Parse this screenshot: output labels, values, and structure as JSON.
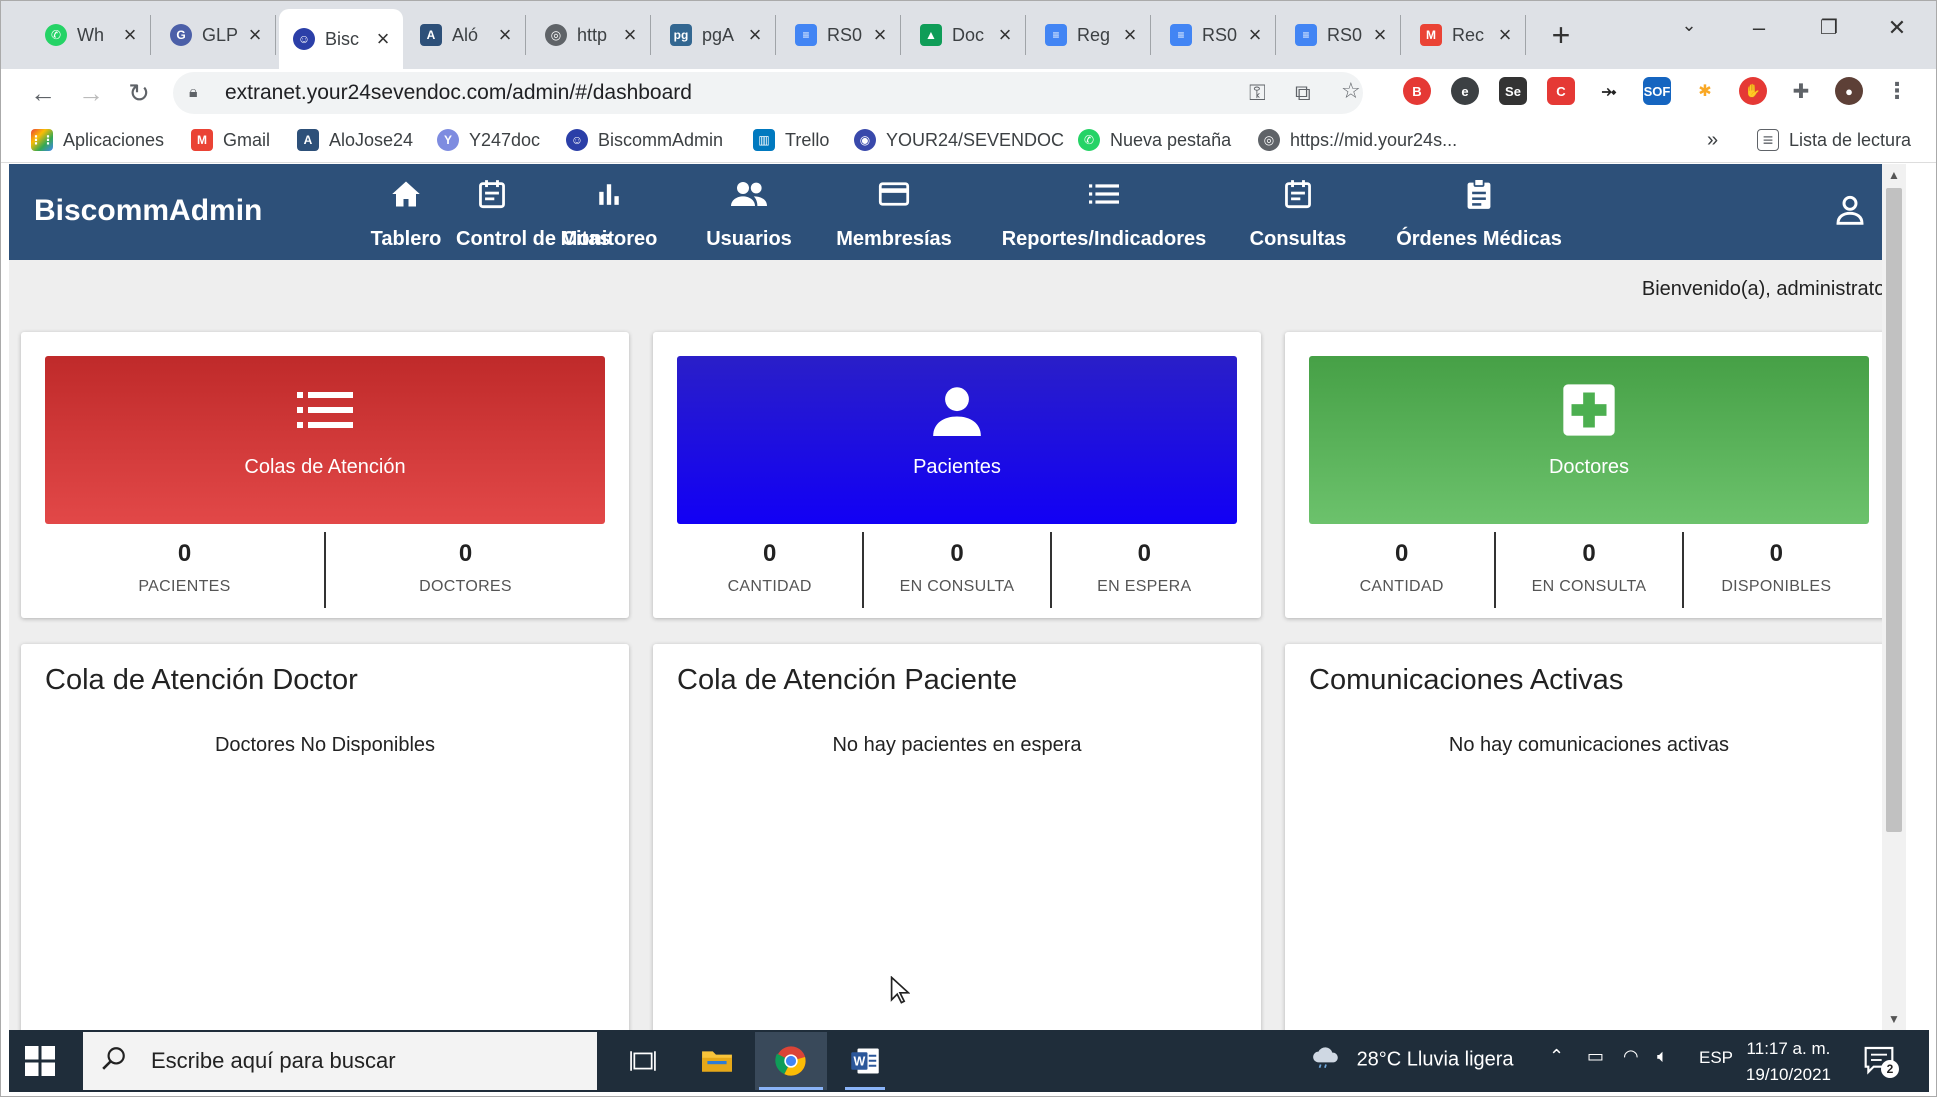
{
  "browser": {
    "tabs": [
      {
        "title": "Wh",
        "favicon": "whatsapp-icon",
        "color": "#25d366"
      },
      {
        "title": "GLP",
        "favicon": "glpi-icon",
        "color": "#4b5fa8"
      },
      {
        "title": "Bisc",
        "favicon": "biscomm-icon",
        "color": "#2b3fa8",
        "active": true
      },
      {
        "title": "Aló",
        "favicon": "alojose-icon",
        "color": "#2d5079"
      },
      {
        "title": "http",
        "favicon": "globe-icon",
        "color": "#5f6368"
      },
      {
        "title": "pgA",
        "favicon": "pgadmin-icon",
        "color": "#336791"
      },
      {
        "title": "RS0",
        "favicon": "docs-icon",
        "color": "#4285f4"
      },
      {
        "title": "Doc",
        "favicon": "drive-icon",
        "color": "#0f9d58"
      },
      {
        "title": "Reg",
        "favicon": "docs-icon",
        "color": "#4285f4"
      },
      {
        "title": "RS0",
        "favicon": "docs-icon",
        "color": "#4285f4"
      },
      {
        "title": "RS0",
        "favicon": "docs-icon",
        "color": "#4285f4"
      },
      {
        "title": "Rec",
        "favicon": "gmail-icon",
        "color": "#ea4335"
      }
    ],
    "url": "extranet.your24sevendoc.com/admin/#/dashboard",
    "bookmarks": [
      {
        "label": "Aplicaciones",
        "icon": "apps-grid-icon"
      },
      {
        "label": "Gmail",
        "icon": "gmail-icon"
      },
      {
        "label": "AloJose24",
        "icon": "alojose-icon"
      },
      {
        "label": "Y247doc",
        "icon": "y247doc-icon"
      },
      {
        "label": "BiscommAdmin",
        "icon": "biscomm-icon"
      },
      {
        "label": "Trello",
        "icon": "trello-icon"
      },
      {
        "label": "YOUR24/SEVENDOC",
        "icon": "your24-icon"
      },
      {
        "label": "Nueva pestaña",
        "icon": "whatsapp-icon"
      },
      {
        "label": "https://mid.your24s...",
        "icon": "globe-icon"
      }
    ],
    "overflow_label": "»",
    "reading_list": "Lista de lectura"
  },
  "app": {
    "brand": "BiscommAdmin",
    "nav": [
      {
        "label": "Tablero",
        "icon": "home-icon"
      },
      {
        "label": "Control de Citas",
        "icon": "calendar-icon"
      },
      {
        "label": "Monitoreo",
        "icon": "bar-chart-icon"
      },
      {
        "label": "Usuarios",
        "icon": "users-icon"
      },
      {
        "label": "Membresías",
        "icon": "credit-card-icon"
      },
      {
        "label": "Reportes/Indicadores",
        "icon": "list-icon"
      },
      {
        "label": "Consultas",
        "icon": "calendar-icon"
      },
      {
        "label": "Órdenes Médicas",
        "icon": "clipboard-icon"
      }
    ],
    "welcome": "Bienvenido(a), administrator",
    "colors": {
      "appbar": "#2d5079",
      "red": "#d32f2f",
      "blue": "#1a0ff0",
      "green": "#4caf50"
    }
  },
  "cards": [
    {
      "title": "Colas de Atención",
      "icon": "list-icon",
      "stats": [
        {
          "value": "0",
          "label": "PACIENTES"
        },
        {
          "value": "0",
          "label": "DOCTORES"
        }
      ]
    },
    {
      "title": "Pacientes",
      "icon": "person-icon",
      "stats": [
        {
          "value": "0",
          "label": "CANTIDAD"
        },
        {
          "value": "0",
          "label": "EN CONSULTA"
        },
        {
          "value": "0",
          "label": "EN ESPERA"
        }
      ]
    },
    {
      "title": "Doctores",
      "icon": "medical-cross-icon",
      "stats": [
        {
          "value": "0",
          "label": "CANTIDAD"
        },
        {
          "value": "0",
          "label": "EN CONSULTA"
        },
        {
          "value": "0",
          "label": "DISPONIBLES"
        }
      ]
    }
  ],
  "panels": [
    {
      "title": "Cola de Atención Doctor",
      "message": "Doctores No Disponibles"
    },
    {
      "title": "Cola de Atención Paciente",
      "message": "No hay pacientes en espera"
    },
    {
      "title": "Comunicaciones Activas",
      "message": "No hay comunicaciones activas"
    }
  ],
  "taskbar": {
    "search_placeholder": "Escribe aquí para buscar",
    "weather": "28°C  Lluvia ligera",
    "language": "ESP",
    "time": "11:17 a. m.",
    "date": "19/10/2021",
    "notifications": "2"
  }
}
